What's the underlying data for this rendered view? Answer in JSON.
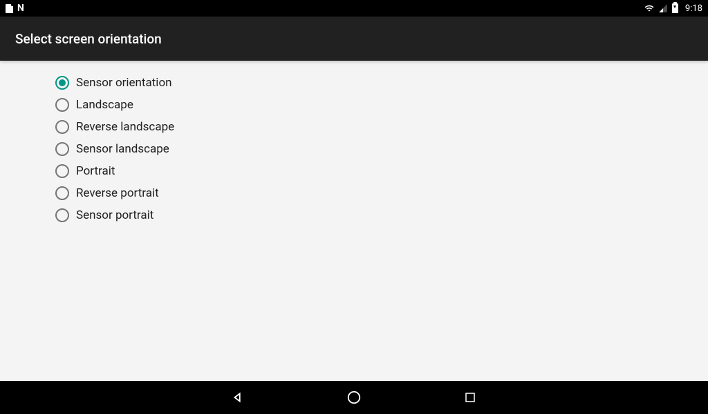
{
  "statusBar": {
    "time": "9:18"
  },
  "appBar": {
    "title": "Select screen orientation"
  },
  "options": [
    {
      "label": "Sensor orientation",
      "selected": true
    },
    {
      "label": "Landscape",
      "selected": false
    },
    {
      "label": "Reverse landscape",
      "selected": false
    },
    {
      "label": "Sensor landscape",
      "selected": false
    },
    {
      "label": "Portrait",
      "selected": false
    },
    {
      "label": "Reverse portrait",
      "selected": false
    },
    {
      "label": "Sensor portrait",
      "selected": false
    }
  ]
}
